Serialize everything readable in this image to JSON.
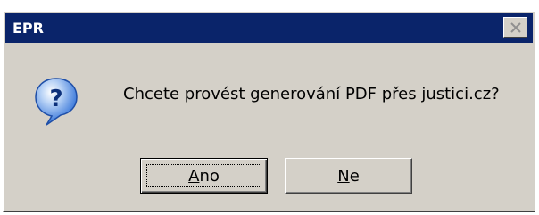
{
  "window": {
    "title": "EPR"
  },
  "dialog": {
    "icon": "question-icon",
    "message": "Chcete provést generování PDF přes justici.cz?"
  },
  "buttons": {
    "yes": {
      "accel": "A",
      "rest": "no"
    },
    "no": {
      "accel": "N",
      "rest": "e"
    }
  },
  "colors": {
    "titlebar": "#0a246a",
    "dialog_bg": "#d4d0c8",
    "icon_blue": "#2b6dd6"
  }
}
